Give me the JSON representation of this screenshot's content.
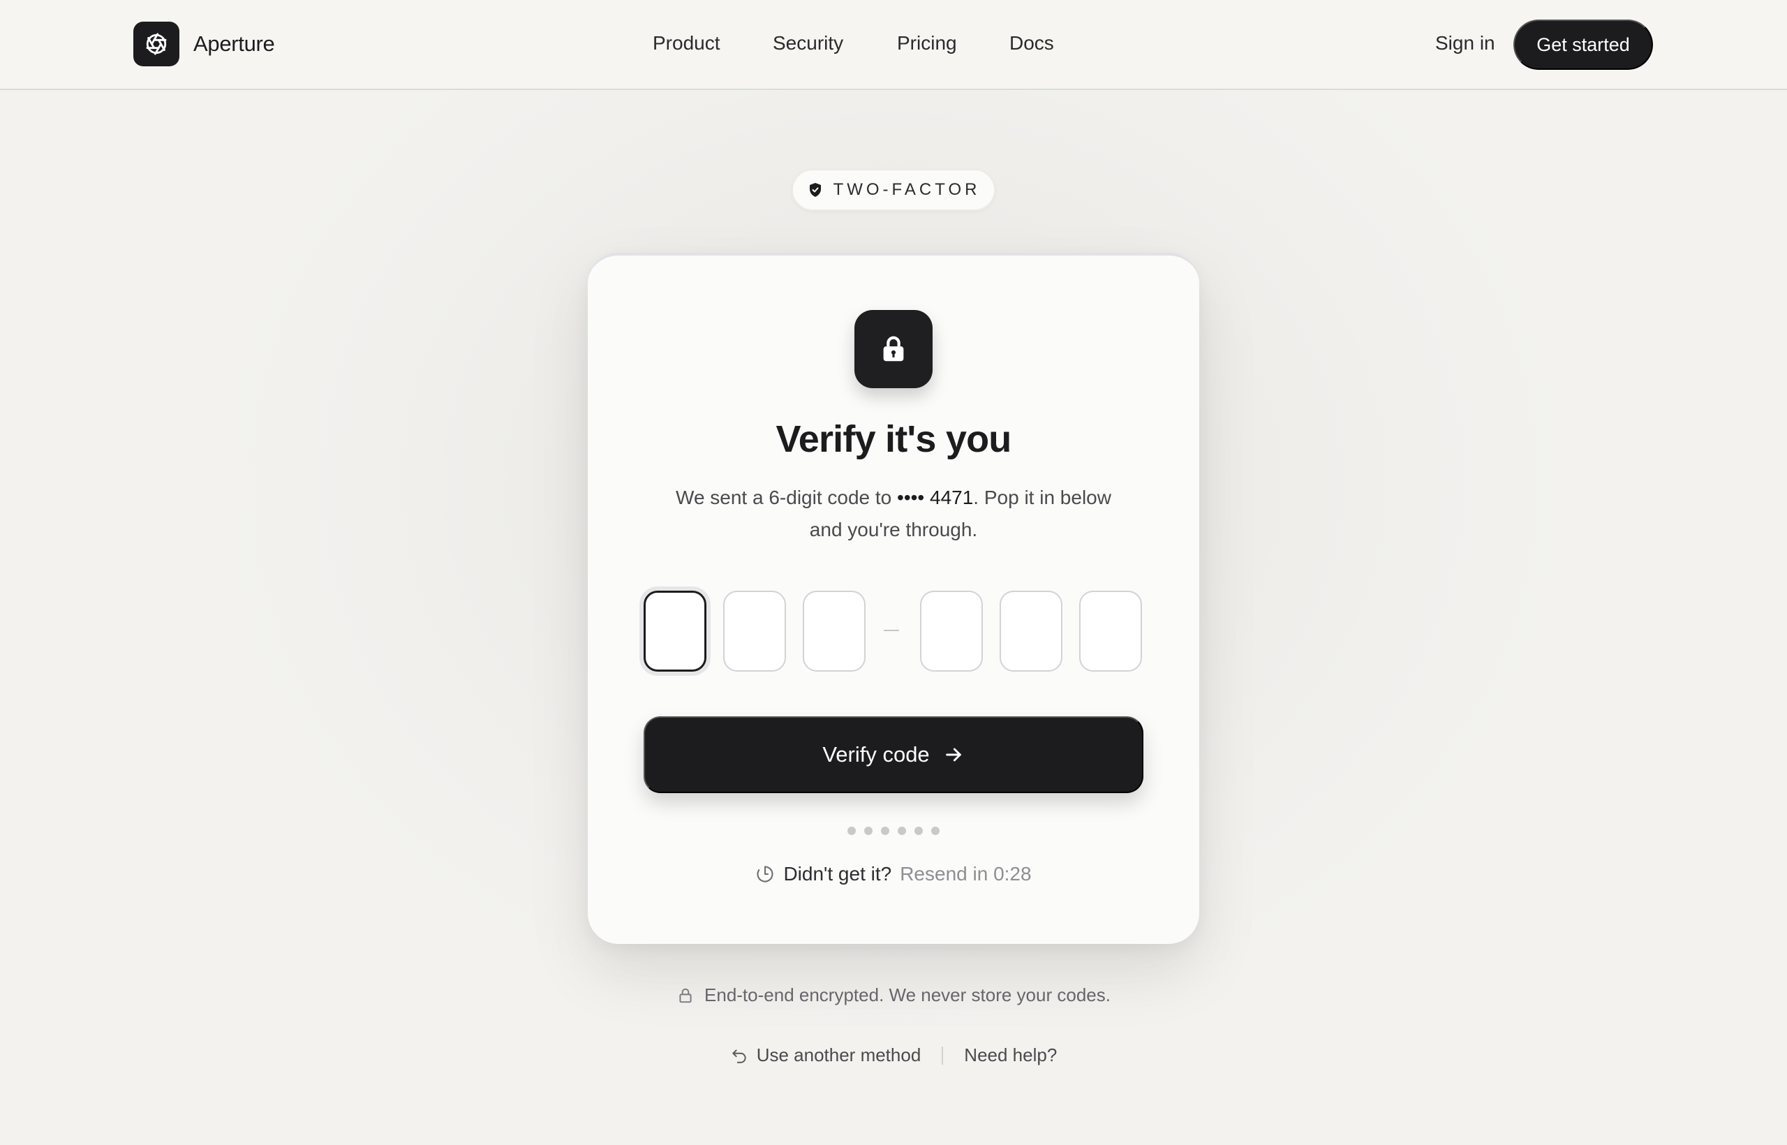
{
  "header": {
    "brand_name": "Aperture",
    "nav": [
      "Product",
      "Security",
      "Pricing",
      "Docs"
    ],
    "sign_in": "Sign in",
    "get_started": "Get started"
  },
  "badge": {
    "label": "TWO-FACTOR"
  },
  "card": {
    "title": "Verify it's you",
    "subtitle_before": "We sent a 6-digit code to ",
    "masked_number": "•••• 4471",
    "subtitle_after": ". Pop it in below and you're through.",
    "otp": {
      "length": 6,
      "values": [
        "",
        "",
        "",
        "",
        "",
        ""
      ],
      "separator": "–"
    },
    "verify_label": "Verify code",
    "progress_dots": 6,
    "resend_question": "Didn't get it?",
    "resend_timer": "Resend in 0:28"
  },
  "footer": {
    "encryption_note": "End-to-end encrypted. We never store your codes.",
    "other_method": "Use another method",
    "help": "Need help?"
  },
  "icons": {
    "brand": "aperture-icon",
    "badge": "shield-check-icon",
    "card": "lock-icon",
    "verify": "arrow-right-icon",
    "timer": "timer-icon",
    "note": "lock-outline-icon",
    "other_method": "undo-icon"
  },
  "colors": {
    "accent": "#1c1c1e",
    "background": "#f3f2ef",
    "card": "#fbfbfa",
    "muted_text": "#8e8e93"
  }
}
